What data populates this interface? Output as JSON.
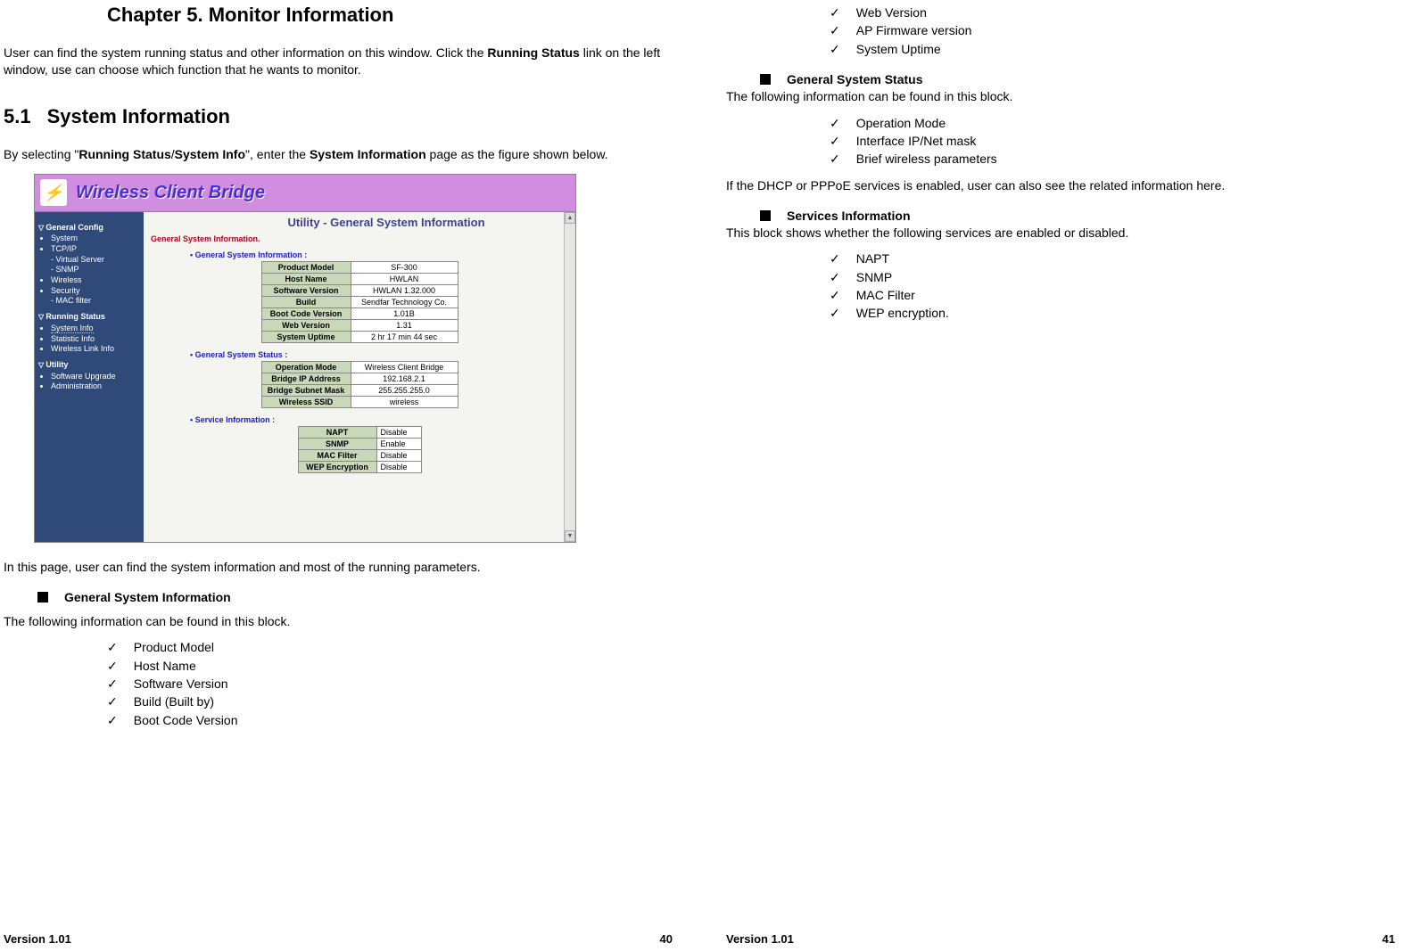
{
  "left": {
    "chapter_title": "Chapter 5. Monitor Information",
    "intro_part1": "User can find the system running status and other information on this window. Click the ",
    "intro_bold": "Running Status",
    "intro_part2": " link on the left window, use can choose which function that he wants to monitor.",
    "section_num": "5.1",
    "section_title": "System Information",
    "para2_a": "By selecting \"",
    "para2_b": "Running Status",
    "para2_c": "/",
    "para2_d": "System Info",
    "para2_e": "\", enter the ",
    "para2_f": "System Information",
    "para2_g": " page as the figure shown below.",
    "after_ss": "In this page, user can find the system information and most of the running parameters.",
    "sub1": "General System Information",
    "sub1_desc": "The following information can be found in this block.",
    "check1": [
      "Product Model",
      "Host Name",
      "Software Version",
      "Build (Built by)",
      "Boot Code Version"
    ],
    "footer_left": "Version 1.01",
    "footer_right": "40"
  },
  "right": {
    "check_top": [
      "Web Version",
      "AP Firmware version",
      "System Uptime"
    ],
    "sub2": "General System Status",
    "sub2_desc": "The following information can be found in this block.",
    "check2": [
      "Operation Mode",
      "Interface IP/Net mask",
      "Brief wireless parameters"
    ],
    "para_dhcp": "If the DHCP or PPPoE services is enabled, user can also see the related information here.",
    "sub3": "Services Information",
    "sub3_desc": "This block shows whether the following services are enabled or disabled.",
    "check3": [
      "NAPT",
      "SNMP",
      "MAC Filter",
      "WEP encryption."
    ],
    "footer_left": "Version 1.01",
    "footer_right": "41"
  },
  "screenshot": {
    "brand": "Wireless Client Bridge",
    "sidebar": {
      "g1": "General Config",
      "g1_items": [
        "System",
        "TCP/IP",
        "- Virtual Server",
        "- SNMP",
        "Wireless",
        "Security",
        "- MAC filter"
      ],
      "g2": "Running Status",
      "g2_items": [
        "System Info",
        "Statistic Info",
        "Wireless Link Info"
      ],
      "g3": "Utility",
      "g3_items": [
        "Software Upgrade",
        "Administration"
      ]
    },
    "main_title": "Utility - General System Information",
    "caption": "General System Information.",
    "sec1_label": "General System Information :",
    "sec1_rows": [
      [
        "Product Model",
        "SF-300"
      ],
      [
        "Host Name",
        "HWLAN"
      ],
      [
        "Software Version",
        "HWLAN 1.32.000"
      ],
      [
        "Build",
        "Sendfar Technology Co."
      ],
      [
        "Boot Code Version",
        "1.01B"
      ],
      [
        "Web Version",
        "1.31"
      ],
      [
        "System Uptime",
        "2 hr 17 min 44 sec"
      ]
    ],
    "sec2_label": "General System Status :",
    "sec2_rows": [
      [
        "Operation Mode",
        "Wireless Client Bridge"
      ],
      [
        "Bridge IP Address",
        "192.168.2.1"
      ],
      [
        "Bridge Subnet Mask",
        "255.255.255.0"
      ],
      [
        "Wireless SSID",
        "wireless"
      ]
    ],
    "sec3_label": "Service Information :",
    "sec3_rows": [
      [
        "NAPT",
        "Disable"
      ],
      [
        "SNMP",
        "Enable"
      ],
      [
        "MAC Filter",
        "Disable"
      ],
      [
        "WEP Encryption",
        "Disable"
      ]
    ]
  }
}
